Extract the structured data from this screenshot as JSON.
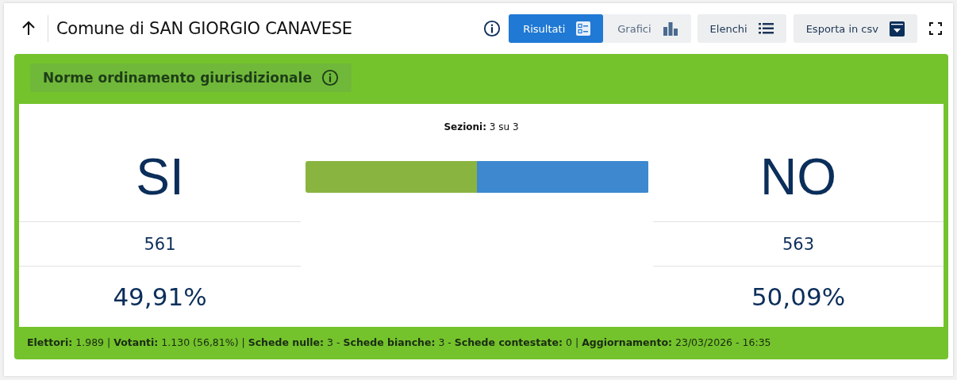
{
  "header": {
    "title": "Comune di SAN GIORGIO CANAVESE"
  },
  "view_tabs": [
    {
      "label": "Risultati",
      "selected": true
    },
    {
      "label": "Grafici",
      "selected": false
    }
  ],
  "buttons": [
    {
      "label": "Elenchi",
      "kind": "list"
    },
    {
      "label": "Esporta in csv",
      "kind": "export"
    }
  ],
  "panel": {
    "title": "Norme ordinamento giurisdizionale",
    "sections": "**Sezioni:** 3 su 3",
    "options": [
      {
        "label": "SI",
        "votes": "561",
        "percent": "49,91%",
        "level": 0.4991,
        "color": "#8ab440"
      },
      {
        "label": "NO",
        "votes": "563",
        "percent": "50,09%",
        "level": 0.5009,
        "color": "#3d88cf"
      }
    ],
    "footer": "**Elettori:** 1.989 | **Votanti:** 1.130 (56,81%) | **Schede nulle:** 3 - **Schede bianche:** 3 - **Schede contestate:** 0 | **Aggiornamento:** 23/03/2026 - 16:35"
  }
}
